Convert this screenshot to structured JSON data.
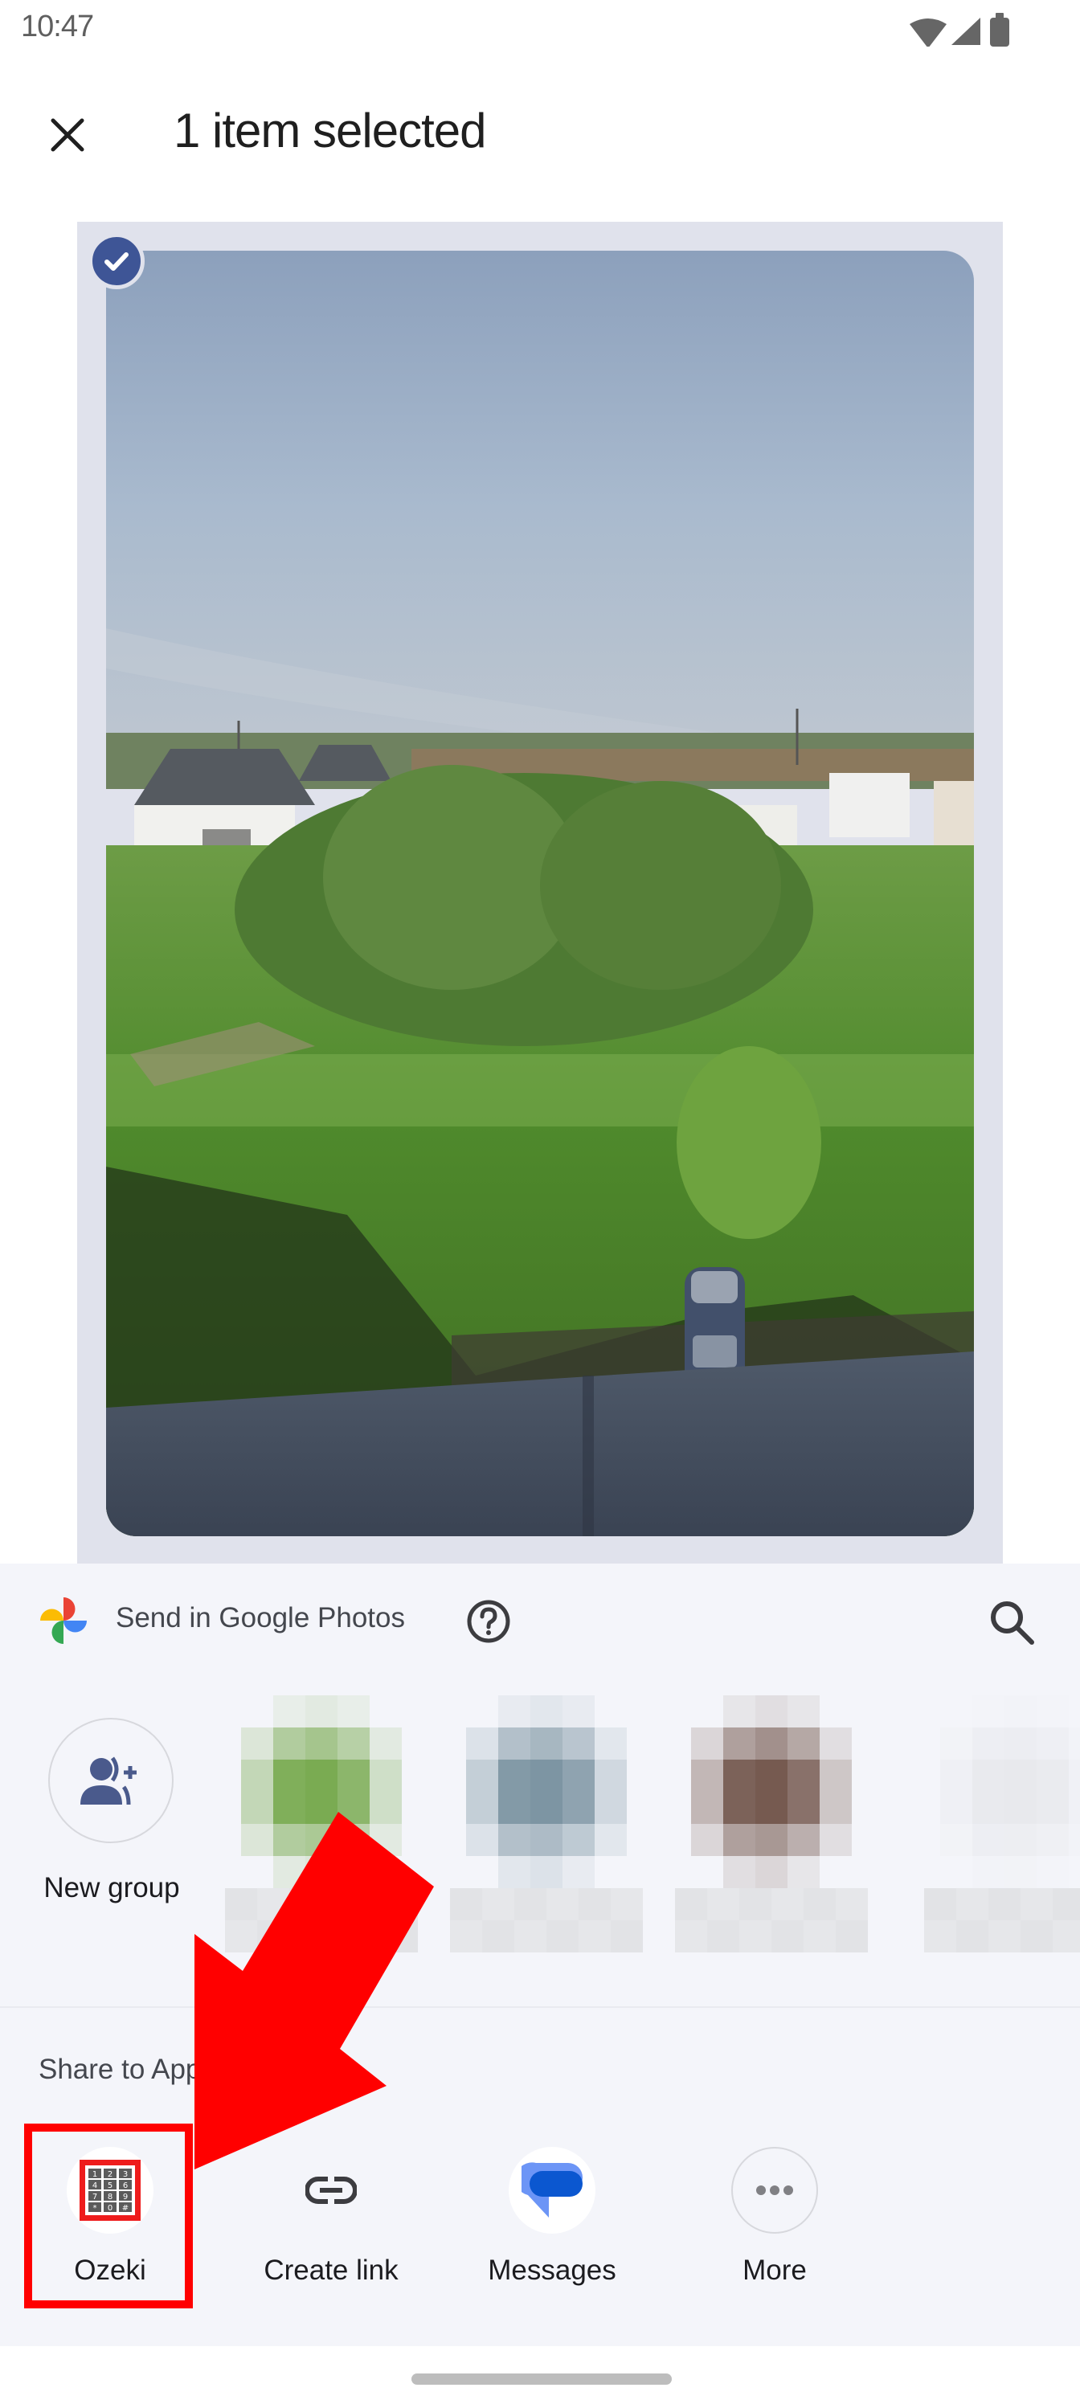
{
  "status_bar": {
    "time": "10:47",
    "icons": [
      "wifi-icon",
      "cellular-signal-icon",
      "battery-icon"
    ]
  },
  "app_bar": {
    "close_icon": "close-icon",
    "title": "1 item selected"
  },
  "selection": {
    "selected_count": 1,
    "check_icon": "check-circle-icon",
    "accent_color": "#3e5596",
    "photo_description": "Landscape photo: sky, white houses, green field with trees, parked car, shadow of balcony"
  },
  "share_sheet": {
    "google_photos": {
      "label": "Send in Google Photos",
      "logo_icon": "google-photos-logo-icon",
      "help_icon": "help-circle-icon",
      "search_icon": "search-icon"
    },
    "contacts": {
      "new_group_label": "New group",
      "new_group_icon": "group-add-icon",
      "blurred_contacts": [
        {
          "color": "#7aab52"
        },
        {
          "color": "#7d95a3"
        },
        {
          "color": "#765a50"
        },
        {
          "color": "#e8e9ed"
        }
      ]
    },
    "share_to_apps_label": "Share to Apps",
    "apps": [
      {
        "label": "Ozeki",
        "icon": "ozeki-keypad-icon",
        "highlighted": true
      },
      {
        "label": "Create link",
        "icon": "link-icon"
      },
      {
        "label": "Messages",
        "icon": "messages-icon"
      },
      {
        "label": "More",
        "icon": "more-horizontal-icon"
      }
    ]
  },
  "ozeki_keys": [
    "1",
    "2",
    "3",
    "4",
    "5",
    "6",
    "7",
    "8",
    "9",
    "*",
    "0",
    "#"
  ],
  "annotation": {
    "arrow_color": "#ff0000",
    "target": "Ozeki"
  }
}
